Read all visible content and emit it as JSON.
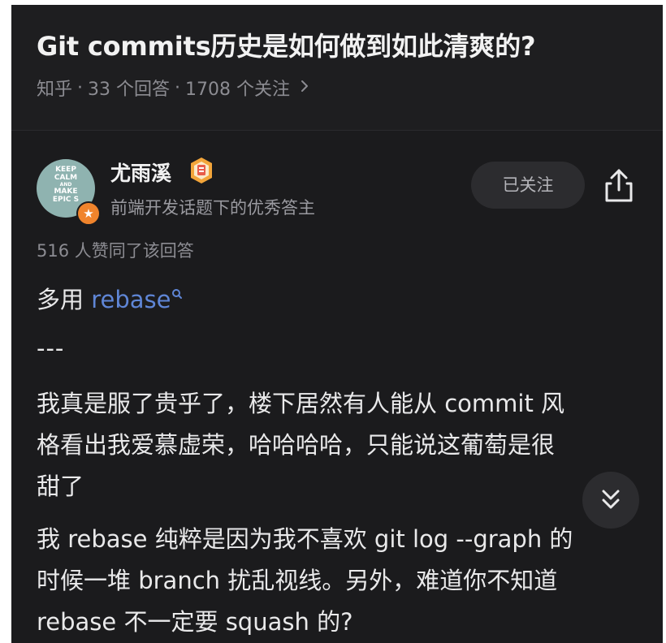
{
  "question": {
    "title": "Git commits历史是如何做到如此清爽的?",
    "source": "知乎",
    "sep1": "·",
    "answers": "33 个回答",
    "sep2": "·",
    "followers": "1708 个关注"
  },
  "author": {
    "avatar_text_1": "KEEP",
    "avatar_text_2": "CALM",
    "avatar_text_3": "AND",
    "avatar_text_4": "MAKE",
    "avatar_text_5": "EPIC S",
    "name": "尤雨溪",
    "description": "前端开发话题下的优秀答主",
    "follow_label": "已关注"
  },
  "answer": {
    "votes": "516 人赞同了该回答",
    "intro": "多用 ",
    "link": "rebase",
    "rule": "---",
    "p2_lines": [
      "我真是服了贵乎了，楼下居然有人能从 commit 风",
      "格看出我爱慕虚荣，哈哈哈哈，只能说这葡萄是很",
      "甜了"
    ],
    "p3_lines": [
      "我 rebase 纯粹是因为我不喜欢 git log --graph 的",
      "时候一堆 branch 扰乱视线。另外，难道你不知道",
      "rebase 不一定要 squash 的?"
    ]
  },
  "colors": {
    "background": "#1b1b1d",
    "text": "#e9e9ea",
    "muted": "#8c8c92",
    "link": "#5f86d6",
    "badge_orange": "#f0842c"
  },
  "icons": {
    "share": "share-icon",
    "chevron": "chevron-right-icon",
    "scroll": "double-chevron-down-icon",
    "badge": "star-badge-icon",
    "search": "search-icon"
  }
}
